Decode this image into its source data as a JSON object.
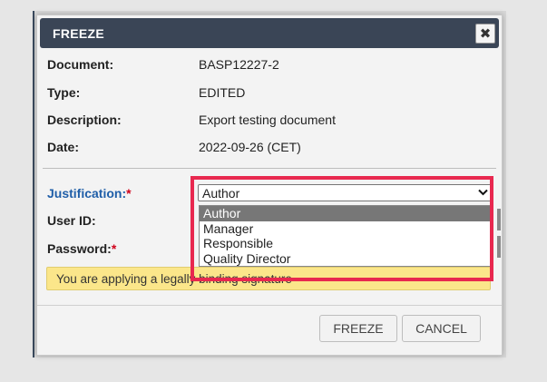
{
  "dialog": {
    "title": "FREEZE",
    "close_glyph": "✖"
  },
  "details": [
    {
      "label": "Document:",
      "value": "BASP12227-2"
    },
    {
      "label": "Type:",
      "value": "EDITED"
    },
    {
      "label": "Description:",
      "value": "Export testing document"
    },
    {
      "label": "Date:",
      "value": "2022-09-26 (CET)"
    }
  ],
  "form": {
    "justification_label": "Justification:",
    "required_mark": "*",
    "user_id_label": "User ID:",
    "password_label": "Password:",
    "justification_selected": "Author",
    "justification_options": [
      "Author",
      "Manager",
      "Responsible",
      "Quality Director"
    ]
  },
  "warning_text": "You are applying a legally binding signature",
  "buttons": {
    "freeze": "FREEZE",
    "cancel": "CANCEL"
  },
  "colors": {
    "titlebar": "#3a4556",
    "justification_label": "#1f5ea8",
    "highlight": "#e8284f",
    "warning_bg": "#fbe68a"
  },
  "icons": {
    "close": "close-icon",
    "dropdown": "chevron-down-icon"
  }
}
